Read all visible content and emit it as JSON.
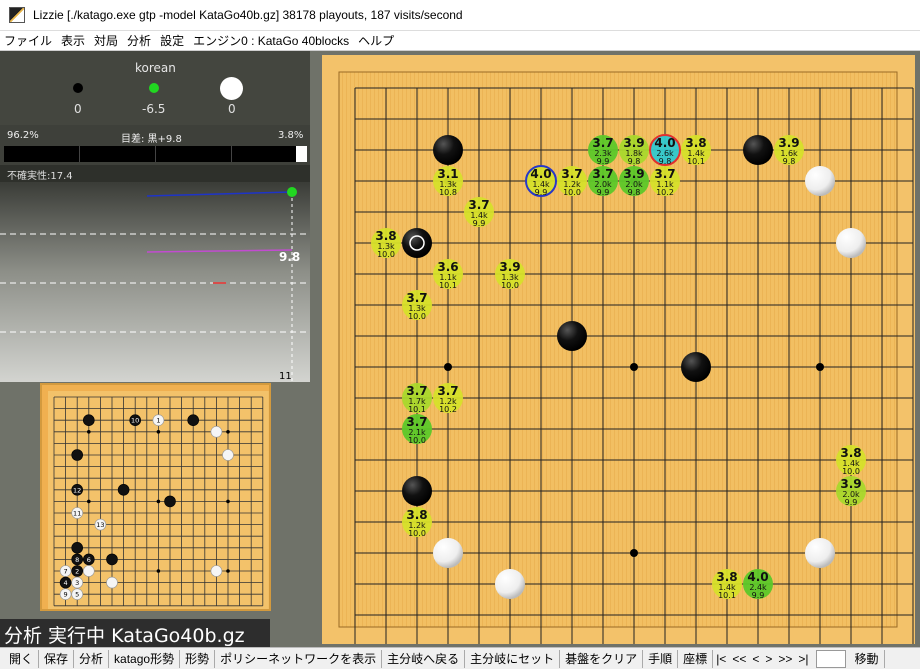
{
  "window": {
    "title": "Lizzie [./katago.exe gtp -model KataGo40b.gz] 38178 playouts, 187 visits/second"
  },
  "menu": [
    "ファイル",
    "表示",
    "対局",
    "分析",
    "設定",
    "エンジン0 : KataGo 40blocks",
    "ヘルプ"
  ],
  "stats": {
    "rules": "korean",
    "black_captures": "0",
    "komi": "-6.5",
    "white_captures": "0"
  },
  "winrate": {
    "black": "96.2%",
    "lead_label": "目差: 黒+9.8",
    "white": "3.8%",
    "black_fraction": 0.962
  },
  "uncertainty": "不確実性:17.4",
  "graph": {
    "score_label": "9.8",
    "move_number": "11"
  },
  "status_text": "分析 実行中 KataGo40b.gz",
  "toolbar": {
    "buttons": [
      "開く",
      "保存",
      "分析",
      "katago形勢",
      "形勢",
      "ポリシーネットワークを表示",
      "主分岐へ戻る",
      "主分岐にセット",
      "碁盤をクリア",
      "手順",
      "座標"
    ],
    "nav": [
      "|<",
      "<<",
      "<",
      ">",
      ">>",
      ">|"
    ],
    "goto": "移動"
  },
  "board": {
    "size": 19,
    "hoshi": [
      [
        3,
        3
      ],
      [
        9,
        3
      ],
      [
        15,
        3
      ],
      [
        3,
        9
      ],
      [
        9,
        9
      ],
      [
        15,
        9
      ],
      [
        3,
        15
      ],
      [
        9,
        15
      ],
      [
        15,
        15
      ]
    ],
    "stones": [
      {
        "x": 3,
        "y": 2,
        "c": "black"
      },
      {
        "x": 13,
        "y": 2,
        "c": "black"
      },
      {
        "x": 15,
        "y": 3,
        "c": "white"
      },
      {
        "x": 2,
        "y": 5,
        "c": "black",
        "last": true
      },
      {
        "x": 16,
        "y": 5,
        "c": "white"
      },
      {
        "x": 7,
        "y": 8,
        "c": "black"
      },
      {
        "x": 11,
        "y": 9,
        "c": "black"
      },
      {
        "x": 2,
        "y": 13,
        "c": "black"
      },
      {
        "x": 3,
        "y": 15,
        "c": "white"
      },
      {
        "x": 15,
        "y": 15,
        "c": "white"
      },
      {
        "x": 5,
        "y": 16,
        "c": "white"
      }
    ],
    "candidates": [
      {
        "x": 8,
        "y": 2,
        "wr": "3.7",
        "v": "2.3k",
        "s": "9.9",
        "tone": "green"
      },
      {
        "x": 9,
        "y": 2,
        "wr": "3.9",
        "v": "1.8k",
        "s": "9.8",
        "tone": "yg"
      },
      {
        "x": 10,
        "y": 2,
        "wr": "4.0",
        "v": "2.6k",
        "s": "9.8",
        "tone": "cyan",
        "best": true
      },
      {
        "x": 11,
        "y": 2,
        "wr": "3.8",
        "v": "1.4k",
        "s": "10.1",
        "tone": "yellow"
      },
      {
        "x": 14,
        "y": 2,
        "wr": "3.9",
        "v": "1.6k",
        "s": "9.8",
        "tone": "yellow"
      },
      {
        "x": 3,
        "y": 3,
        "wr": "3.1",
        "v": "1.3k",
        "s": "10.8",
        "tone": "yellow"
      },
      {
        "x": 6,
        "y": 3,
        "wr": "4.0",
        "v": "1.4k",
        "s": "9.9",
        "tone": "yellow",
        "ring": true
      },
      {
        "x": 7,
        "y": 3,
        "wr": "3.7",
        "v": "1.2k",
        "s": "10.0",
        "tone": "yellow"
      },
      {
        "x": 8,
        "y": 3,
        "wr": "3.7",
        "v": "2.0k",
        "s": "9.9",
        "tone": "green"
      },
      {
        "x": 9,
        "y": 3,
        "wr": "3.9",
        "v": "2.0k",
        "s": "9.8",
        "tone": "green"
      },
      {
        "x": 10,
        "y": 3,
        "wr": "3.7",
        "v": "1.1k",
        "s": "10.2",
        "tone": "yellow"
      },
      {
        "x": 4,
        "y": 4,
        "wr": "3.7",
        "v": "1.4k",
        "s": "9.9",
        "tone": "yellow"
      },
      {
        "x": 1,
        "y": 5,
        "wr": "3.8",
        "v": "1.3k",
        "s": "10.0",
        "tone": "yellow"
      },
      {
        "x": 3,
        "y": 6,
        "wr": "3.6",
        "v": "1.1k",
        "s": "10.1",
        "tone": "yellow"
      },
      {
        "x": 5,
        "y": 6,
        "wr": "3.9",
        "v": "1.3k",
        "s": "10.0",
        "tone": "yellow"
      },
      {
        "x": 2,
        "y": 7,
        "wr": "3.7",
        "v": "1.3k",
        "s": "10.0",
        "tone": "yellow"
      },
      {
        "x": 2,
        "y": 10,
        "wr": "3.7",
        "v": "1.7k",
        "s": "10.1",
        "tone": "yg"
      },
      {
        "x": 3,
        "y": 10,
        "wr": "3.7",
        "v": "1.2k",
        "s": "10.2",
        "tone": "yellow"
      },
      {
        "x": 2,
        "y": 11,
        "wr": "3.7",
        "v": "2.1k",
        "s": "10.0",
        "tone": "green"
      },
      {
        "x": 16,
        "y": 12,
        "wr": "3.8",
        "v": "1.4k",
        "s": "10.0",
        "tone": "yellow"
      },
      {
        "x": 16,
        "y": 13,
        "wr": "3.9",
        "v": "2.0k",
        "s": "9.9",
        "tone": "yg"
      },
      {
        "x": 2,
        "y": 14,
        "wr": "3.8",
        "v": "1.2k",
        "s": "10.0",
        "tone": "yellow"
      },
      {
        "x": 12,
        "y": 16,
        "wr": "3.8",
        "v": "1.4k",
        "s": "10.1",
        "tone": "yellow"
      },
      {
        "x": 13,
        "y": 16,
        "wr": "4.0",
        "v": "2.4k",
        "s": "9.9",
        "tone": "green"
      }
    ],
    "colors": {
      "yellow": "#d6e02a",
      "yg": "#a9d82c",
      "green": "#5cc829",
      "cyan": "#2fc9cf"
    }
  },
  "mini": {
    "stones": [
      {
        "x": 3,
        "y": 2,
        "c": "black",
        "n": ""
      },
      {
        "x": 7,
        "y": 2,
        "c": "black",
        "n": "10"
      },
      {
        "x": 9,
        "y": 2,
        "c": "white",
        "n": "1"
      },
      {
        "x": 12,
        "y": 2,
        "c": "black",
        "n": ""
      },
      {
        "x": 14,
        "y": 3,
        "c": "white",
        "n": ""
      },
      {
        "x": 2,
        "y": 5,
        "c": "black",
        "n": ""
      },
      {
        "x": 15,
        "y": 5,
        "c": "white",
        "n": ""
      },
      {
        "x": 2,
        "y": 8,
        "c": "black",
        "n": "12"
      },
      {
        "x": 6,
        "y": 8,
        "c": "black",
        "n": ""
      },
      {
        "x": 10,
        "y": 9,
        "c": "black",
        "n": ""
      },
      {
        "x": 2,
        "y": 10,
        "c": "white",
        "n": "11"
      },
      {
        "x": 4,
        "y": 11,
        "c": "white",
        "n": "13"
      },
      {
        "x": 2,
        "y": 13,
        "c": "black",
        "n": ""
      },
      {
        "x": 2,
        "y": 14,
        "c": "black",
        "n": "8"
      },
      {
        "x": 3,
        "y": 14,
        "c": "black",
        "n": "6"
      },
      {
        "x": 5,
        "y": 14,
        "c": "black",
        "n": ""
      },
      {
        "x": 1,
        "y": 15,
        "c": "white",
        "n": "7"
      },
      {
        "x": 2,
        "y": 15,
        "c": "black",
        "n": "2"
      },
      {
        "x": 3,
        "y": 15,
        "c": "white",
        "n": ""
      },
      {
        "x": 14,
        "y": 15,
        "c": "white",
        "n": ""
      },
      {
        "x": 1,
        "y": 16,
        "c": "black",
        "n": "4"
      },
      {
        "x": 2,
        "y": 16,
        "c": "white",
        "n": "3"
      },
      {
        "x": 5,
        "y": 16,
        "c": "white",
        "n": ""
      },
      {
        "x": 1,
        "y": 17,
        "c": "white",
        "n": "9"
      },
      {
        "x": 2,
        "y": 17,
        "c": "white",
        "n": "5"
      }
    ]
  }
}
